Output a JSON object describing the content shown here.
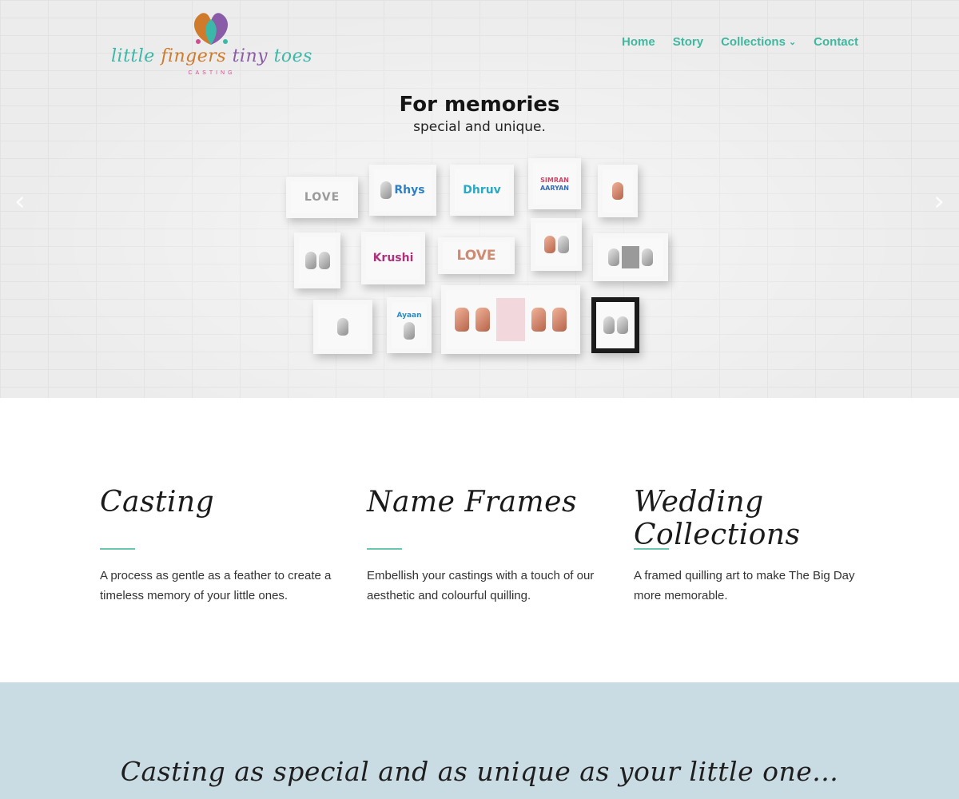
{
  "brand": {
    "logo_words": [
      "little",
      "fingers",
      "tiny",
      "toes"
    ],
    "logo_sub": "CASTING",
    "colors": {
      "teal": "#3fb8a0",
      "orange": "#d07a2b",
      "purple": "#8a5ba6",
      "pink": "#d24c8f"
    }
  },
  "nav": {
    "items": [
      {
        "label": "Home"
      },
      {
        "label": "Story"
      },
      {
        "label": "Collections",
        "has_dropdown": true,
        "caret": "⌄"
      },
      {
        "label": "Contact"
      }
    ]
  },
  "hero": {
    "title": "For memories",
    "subtitle": "special and unique.",
    "prev_arrow": "‹",
    "next_arrow": "›",
    "frame_labels": {
      "love1": "LOVE",
      "rhys": "Rhys",
      "dhruv": "Dhruv",
      "simran": "SIMRAN",
      "aaryan": "AARYAN",
      "krushi": "Krushi",
      "love2": "LOVE",
      "ayaan": "Ayaan"
    }
  },
  "features": [
    {
      "title": "Casting",
      "text": "A process as gentle as a feather to create a timeless memory of your little ones."
    },
    {
      "title": "Name Frames",
      "text": "Embellish your castings with a touch of our aesthetic and colourful quilling."
    },
    {
      "title": "Wedding Collections",
      "text": "A framed quilling art to make The Big Day more memorable."
    }
  ],
  "band": {
    "heading": "Casting as special and as unique as your little one..."
  },
  "colors": {
    "accent": "#3fb8a0",
    "rule": "#69c6b0",
    "band_bg": "#cadce3",
    "hero_bg": "#ececec"
  }
}
